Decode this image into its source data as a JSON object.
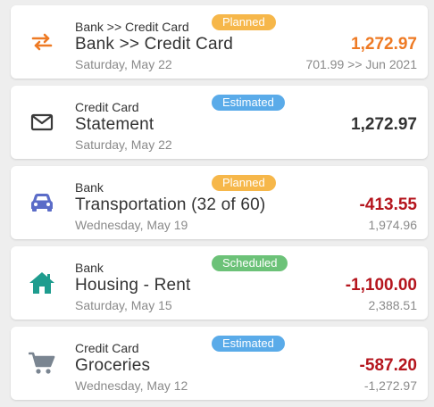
{
  "colors": {
    "planned": "#F6B74A",
    "estimated": "#5AABE9",
    "scheduled": "#6CC278",
    "positive": "#EE7A24",
    "neutral": "#333333",
    "negative": "#B5161E",
    "transfer_icon": "#EE7A24",
    "statement_icon": "#3A3A3A",
    "car_icon": "#5B6CC8",
    "home_icon": "#1E9C8E",
    "cart_icon": "#7A8591"
  },
  "transactions": [
    {
      "icon": "transfer-arrows-icon",
      "account": "Bank >> Credit Card",
      "status": "Planned",
      "title": "Bank >> Credit Card",
      "date": "Saturday, May 22",
      "amount": "1,272.97",
      "subamount": "701.99 >> Jun 2021"
    },
    {
      "icon": "envelope-icon",
      "account": "Credit Card",
      "status": "Estimated",
      "title": "Statement",
      "date": "Saturday, May 22",
      "amount": "1,272.97",
      "subamount": ""
    },
    {
      "icon": "car-icon",
      "account": "Bank",
      "status": "Planned",
      "title": "Transportation (32 of 60)",
      "date": "Wednesday, May 19",
      "amount": "-413.55",
      "subamount": "1,974.96"
    },
    {
      "icon": "home-icon",
      "account": "Bank",
      "status": "Scheduled",
      "title": "Housing - Rent",
      "date": "Saturday, May 15",
      "amount": "-1,100.00",
      "subamount": "2,388.51"
    },
    {
      "icon": "shopping-cart-icon",
      "account": "Credit Card",
      "status": "Estimated",
      "title": "Groceries",
      "date": "Wednesday, May 12",
      "amount": "-587.20",
      "subamount": "-1,272.97"
    }
  ]
}
